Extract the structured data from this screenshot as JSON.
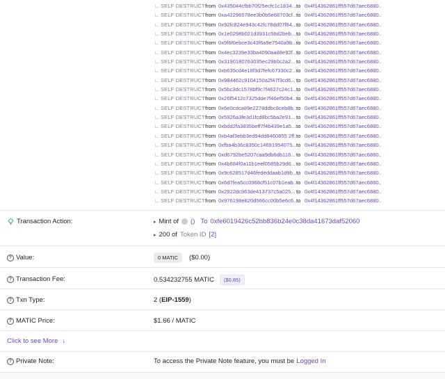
{
  "self_destructs": {
    "label": "SELF DESTRUCT",
    "from_word": "from",
    "to_word": "to",
    "rows": [
      {
        "from": "0x435044cfbb70f25ecfc1c1834...",
        "to": "0x4f14362861ff557d67aec6880..."
      },
      {
        "from": "0xa42296578ee3b0b5e68703cf...",
        "to": "0x4f14362861ff557d67aec6880..."
      },
      {
        "from": "0x92fc824e943c42fc78dd07f84...",
        "to": "0x4f14362861ff557d67aec6880..."
      },
      {
        "from": "0x1e0298b021d3931c5bd2beb...",
        "to": "0x4f14362861ff557d67aec6880..."
      },
      {
        "from": "0x9f6f0ebce3c43f6a9e7540a9b...",
        "to": "0x4f14362861ff557d67aec6880..."
      },
      {
        "from": "0x4ec3239e33ba4090aa88e92f...",
        "to": "0x4f14362861ff557d67aec6880..."
      },
      {
        "from": "0x3190180763035ec29b0c2a2...",
        "to": "0x4f14362861ff557d67aec6880..."
      },
      {
        "from": "0xb635cd4e18f3d7fefc67330c2...",
        "to": "0x4f14362861ff557d67aec6880..."
      },
      {
        "from": "0x984462c9104150a2f47f3cd6...",
        "to": "0x4f14362861ff557d67aec6880..."
      },
      {
        "from": "0x5bc3dc1578bf9c7f4627c24c1...",
        "to": "0x4f14362861ff557d67aec6880..."
      },
      {
        "from": "0x26f5412c7325dde7f46ef50b4...",
        "to": "0x4f14362861ff557d67aec6880..."
      },
      {
        "from": "0x6e0cdca89e2278ddbc8ceb8b...",
        "to": "0x4f14362861ff557d67aec6880..."
      },
      {
        "from": "0x5926a3fe3d1fcd8bc5ba2e91...",
        "to": "0x4f14362861ff557d67aec6880..."
      },
      {
        "from": "0xbdd2fa3835beff7f4b439e1a5...",
        "to": "0x4f14362861ff557d67aec6880..."
      },
      {
        "from": "0xb4af3ebb3ed94dd8460855 2ff...",
        "to": "0x4f14362861ff557d67aec6880..."
      },
      {
        "from": "0xfba4b36c8350c14691954075...",
        "to": "0x4f14362861ff557d67aec6880..."
      },
      {
        "from": "0xd6792be5207caa9db6db116...",
        "to": "0x4f14362861ff557d67aec6880..."
      },
      {
        "from": "0x4b684f0a11b1eef0585b29d6...",
        "to": "0x4f14362861ff557d67aec6880..."
      },
      {
        "from": "0x9c628517d46fededdaab1d9b...",
        "to": "0x4f14362861ff557d67aec6880..."
      },
      {
        "from": "0x6d7fea5cc0968cf51c07b1eab...",
        "to": "0x4f14362861ff557d67aec6880..."
      },
      {
        "from": "0x2922dc963de413737c5a025...",
        "to": "0x4f14362861ff557d67aec6880..."
      },
      {
        "from": "0x976198e820d566cc00b5e6c6...",
        "to": "0x4f14362861ff557d67aec6880..."
      }
    ]
  },
  "transaction_action": {
    "label": "Transaction Action:",
    "mint_text": "Mint of",
    "token_parens": "()",
    "to_word": "To",
    "to_address": "0xfe6019426c52bb836b24e0c38da41673daf52060",
    "amount_prefix": "200 of",
    "token_id_label": "Token ID",
    "token_id": "[2]"
  },
  "value": {
    "label": "Value:",
    "badge": "0 MATIC",
    "usd": "($0.00)"
  },
  "fee": {
    "label": "Transaction Fee:",
    "amount": "0.534232755 MATIC",
    "usd": "($0.85)"
  },
  "txn_type": {
    "label": "Txn Type:",
    "value_prefix": "2 (",
    "type_name": "EIP-1559",
    "value_suffix": ")"
  },
  "price": {
    "label": "MATIC Price:",
    "value": "$1.66 / MATIC"
  },
  "more": {
    "label": "Click to see More",
    "arrow": "↓"
  },
  "private_note": {
    "label": "Private Note:",
    "text": "To access the Private Note feature, you must be",
    "link": "Logged In"
  },
  "colors": {
    "link": "#6f42c1",
    "text": "#1e2022",
    "muted": "#77838f"
  }
}
